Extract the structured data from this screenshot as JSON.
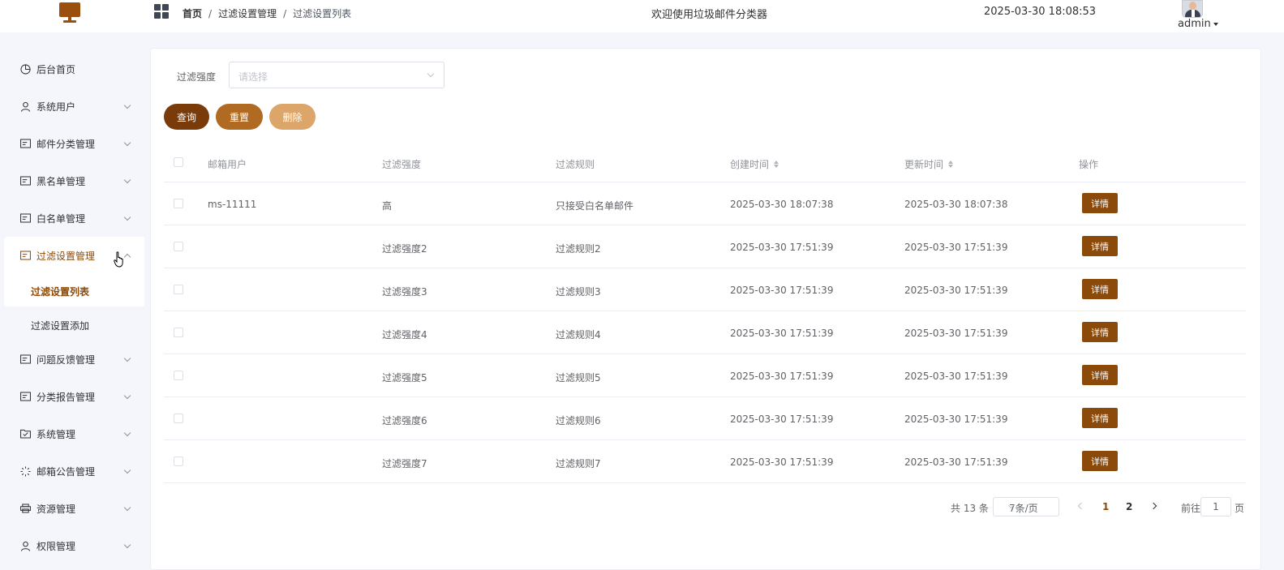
{
  "header": {
    "breadcrumb": [
      "首页",
      "过滤设置管理",
      "过滤设置列表"
    ],
    "breadcrumb_sep": "/",
    "title": "欢迎使用垃圾邮件分类器",
    "datetime": "2025-03-30 18:08:53",
    "user": "admin"
  },
  "sidebar": {
    "items": [
      {
        "label": "后台首页",
        "icon": "dashboard-icon"
      },
      {
        "label": "系统用户",
        "icon": "user-icon"
      },
      {
        "label": "邮件分类管理",
        "icon": "card-icon"
      },
      {
        "label": "黑名单管理",
        "icon": "card-icon"
      },
      {
        "label": "白名单管理",
        "icon": "card-icon"
      },
      {
        "label": "过滤设置管理",
        "icon": "card-icon"
      },
      {
        "label": "问题反馈管理",
        "icon": "card-icon"
      },
      {
        "label": "分类报告管理",
        "icon": "card-icon"
      },
      {
        "label": "系统管理",
        "icon": "check-folder-icon"
      },
      {
        "label": "邮箱公告管理",
        "icon": "loading-icon"
      },
      {
        "label": "资源管理",
        "icon": "printer-icon"
      },
      {
        "label": "权限管理",
        "icon": "user-icon"
      }
    ],
    "sub_items": [
      {
        "label": "过滤设置列表"
      },
      {
        "label": "过滤设置添加"
      }
    ]
  },
  "filter": {
    "label": "过滤强度",
    "placeholder": "请选择"
  },
  "buttons": {
    "query": "查询",
    "reset": "重置",
    "delete": "删除"
  },
  "table": {
    "columns": [
      "邮箱用户",
      "过滤强度",
      "过滤规则",
      "创建时间",
      "更新时间",
      "操作"
    ],
    "action_label": "详情",
    "rows": [
      {
        "user": "ms-11111",
        "strength": "高",
        "rule": "只接受白名单邮件",
        "created": "2025-03-30 18:07:38",
        "updated": "2025-03-30 18:07:38"
      },
      {
        "user": "",
        "strength": "过滤强度2",
        "rule": "过滤规则2",
        "created": "2025-03-30 17:51:39",
        "updated": "2025-03-30 17:51:39"
      },
      {
        "user": "",
        "strength": "过滤强度3",
        "rule": "过滤规则3",
        "created": "2025-03-30 17:51:39",
        "updated": "2025-03-30 17:51:39"
      },
      {
        "user": "",
        "strength": "过滤强度4",
        "rule": "过滤规则4",
        "created": "2025-03-30 17:51:39",
        "updated": "2025-03-30 17:51:39"
      },
      {
        "user": "",
        "strength": "过滤强度5",
        "rule": "过滤规则5",
        "created": "2025-03-30 17:51:39",
        "updated": "2025-03-30 17:51:39"
      },
      {
        "user": "",
        "strength": "过滤强度6",
        "rule": "过滤规则6",
        "created": "2025-03-30 17:51:39",
        "updated": "2025-03-30 17:51:39"
      },
      {
        "user": "",
        "strength": "过滤强度7",
        "rule": "过滤规则7",
        "created": "2025-03-30 17:51:39",
        "updated": "2025-03-30 17:51:39"
      }
    ]
  },
  "pagination": {
    "total": "共 13 条",
    "page_size": "7条/页",
    "pages": [
      "1",
      "2"
    ],
    "jump_prefix": "前往",
    "jump_value": "1",
    "jump_suffix": "页"
  },
  "colors": {
    "accent": "#8b4a0a",
    "query_button": "#7a3b0a",
    "reset_button": "#b06a22",
    "delete_button": "#dca56a"
  }
}
